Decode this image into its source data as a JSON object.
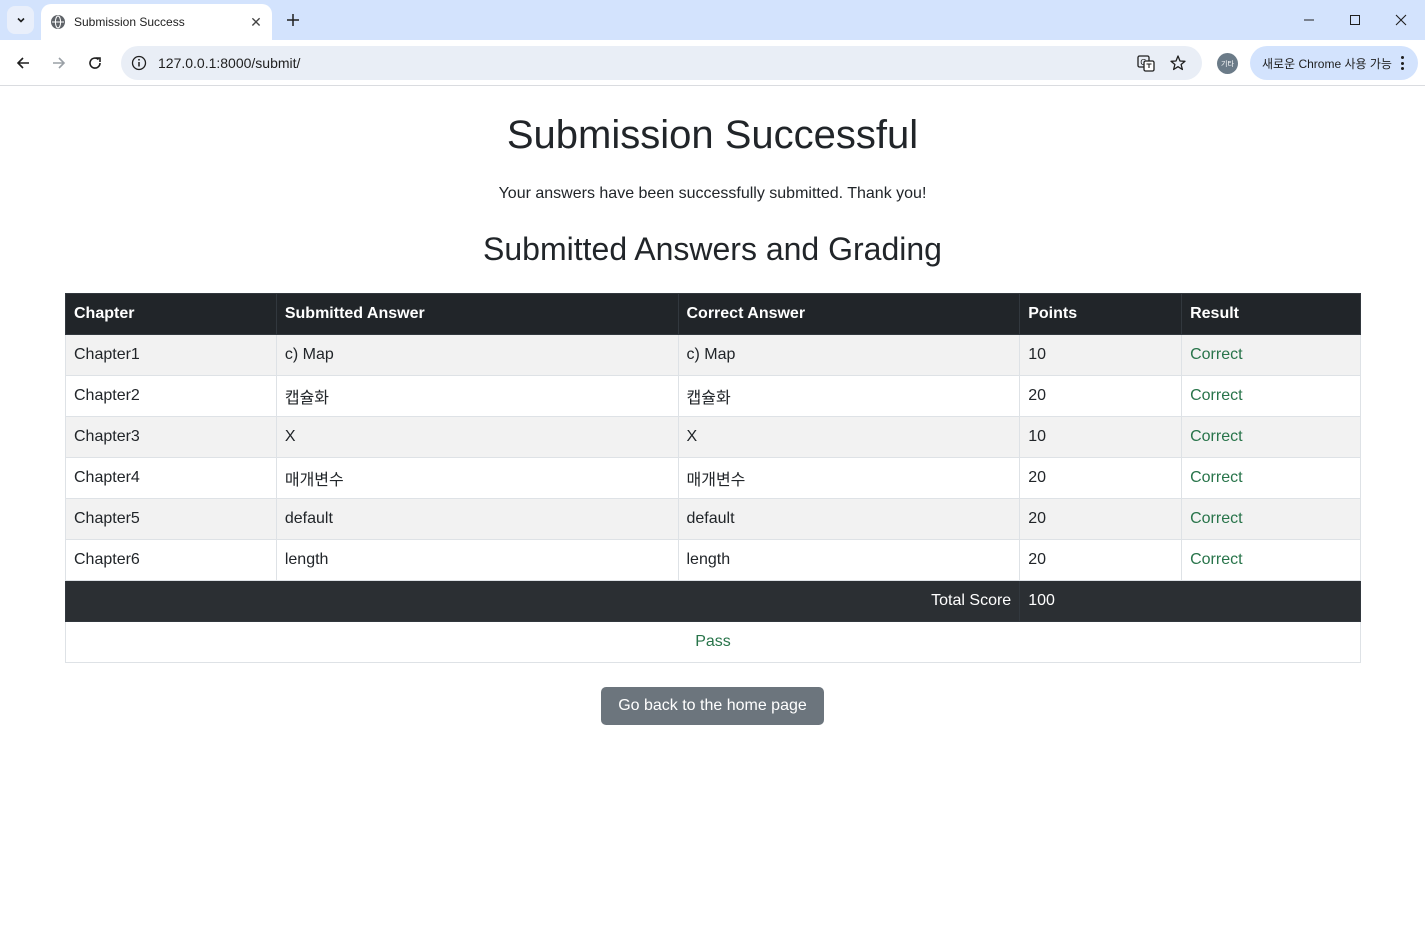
{
  "browser": {
    "tab_title": "Submission Success",
    "url": "127.0.0.1:8000/submit/",
    "profile_label": "기타",
    "update_label": "새로운 Chrome 사용 가능"
  },
  "page": {
    "title": "Submission Successful",
    "message": "Your answers have been successfully submitted. Thank you!",
    "section_title": "Submitted Answers and Grading",
    "button_label": "Go back to the home page"
  },
  "table": {
    "headers": [
      "Chapter",
      "Submitted Answer",
      "Correct Answer",
      "Points",
      "Result"
    ],
    "rows": [
      [
        "Chapter1",
        "c) Map",
        "c) Map",
        "10",
        "Correct"
      ],
      [
        "Chapter2",
        "캡슐화",
        "캡슐화",
        "20",
        "Correct"
      ],
      [
        "Chapter3",
        "X",
        "X",
        "10",
        "Correct"
      ],
      [
        "Chapter4",
        "매개변수",
        "매개변수",
        "20",
        "Correct"
      ],
      [
        "Chapter5",
        "default",
        "default",
        "20",
        "Correct"
      ],
      [
        "Chapter6",
        "length",
        "length",
        "20",
        "Correct"
      ]
    ],
    "total_label": "Total Score",
    "total_value": "100",
    "status": "Pass"
  },
  "colors": {
    "header_bg": "#212529",
    "result_text": "#28744a",
    "button_bg": "#6c757d",
    "chrome_tabstrip": "#d3e3fd"
  }
}
